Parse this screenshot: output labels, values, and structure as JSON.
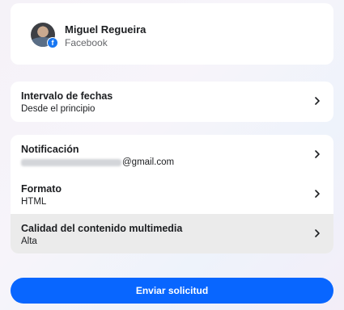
{
  "account": {
    "name": "Miguel Regueira",
    "network": "Facebook"
  },
  "date_range": {
    "title": "Intervalo de fechas",
    "value": "Desde el principio"
  },
  "settings": [
    {
      "title": "Notificación",
      "value": "@gmail.com"
    },
    {
      "title": "Formato",
      "value": "HTML"
    },
    {
      "title": "Calidad del contenido multimedia",
      "value": "Alta"
    }
  ],
  "submit_label": "Enviar solicitud",
  "colors": {
    "accent": "#0866ff",
    "facebook_badge": "#1877f2",
    "highlight_row": "#ebebeb"
  },
  "icons": {
    "avatar": "profile-photo",
    "badge": "facebook-icon",
    "row_action": "chevron-right-icon"
  }
}
